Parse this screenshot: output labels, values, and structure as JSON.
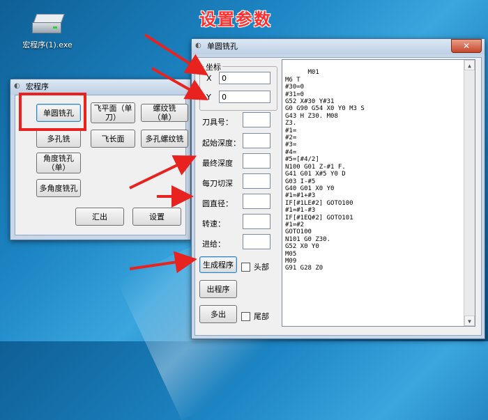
{
  "desktop": {
    "icon_label": "宏程序(1).exe",
    "annotation_title": "设置参数"
  },
  "main_window": {
    "title": "宏程序",
    "buttons": {
      "single_hole": "单圆铣孔",
      "fly_plane_single": "飞平面（单刀）",
      "thread_mill_single": "螺纹铣（单）",
      "multi_hole": "多孔铣",
      "fly_long_face": "飞长面",
      "multi_thread_mill": "多孔螺纹铣",
      "angle_hole_single": "角度铣孔（单）",
      "multi_angle_hole": "多角度铣孔",
      "export": "汇出",
      "settings": "设置"
    }
  },
  "dialog": {
    "title": "单圆铣孔",
    "close_glyph": "✕",
    "coords_legend": "坐标",
    "x_label": "X",
    "y_label": "Y",
    "x_value": "0",
    "y_value": "0",
    "fields": {
      "tool_no": "刀具号：",
      "start_depth": "起始深度：",
      "final_depth": "最终深度",
      "cut_per_pass": "每刀切深",
      "diameter": "圆直径：",
      "speed": "转速：",
      "feed": "进给："
    },
    "buttons": {
      "generate": "生成程序",
      "output": "出程序",
      "multi_output": "多出"
    },
    "checkboxes": {
      "header": "头部",
      "footer": "尾部"
    },
    "code": "M01\nM6 T\n#30=0\n#31=0\nG52 X#30 Y#31\nG0 G90 G54 X0 Y0 M3 S\nG43 H Z30. M08\nZ3.\n#1=\n#2=\n#3=\n#4=\n#5=[#4/2]\nN100 G01 Z-#1 F.\nG41 G01 X#5 Y0 D\nG03 I-#5\nG40 G01 X0 Y0\n#1=#1+#3\nIF[#1LE#2] GOTO100\n#1=#1-#3\nIF[#1EQ#2] GOTO101\n#1=#2\nGOTO100\nN101 G0 Z30.\nG52 X0 Y0\nM05\nM09\nG91 G28 Z0"
  },
  "colors": {
    "annotation_red": "#e8231f"
  }
}
